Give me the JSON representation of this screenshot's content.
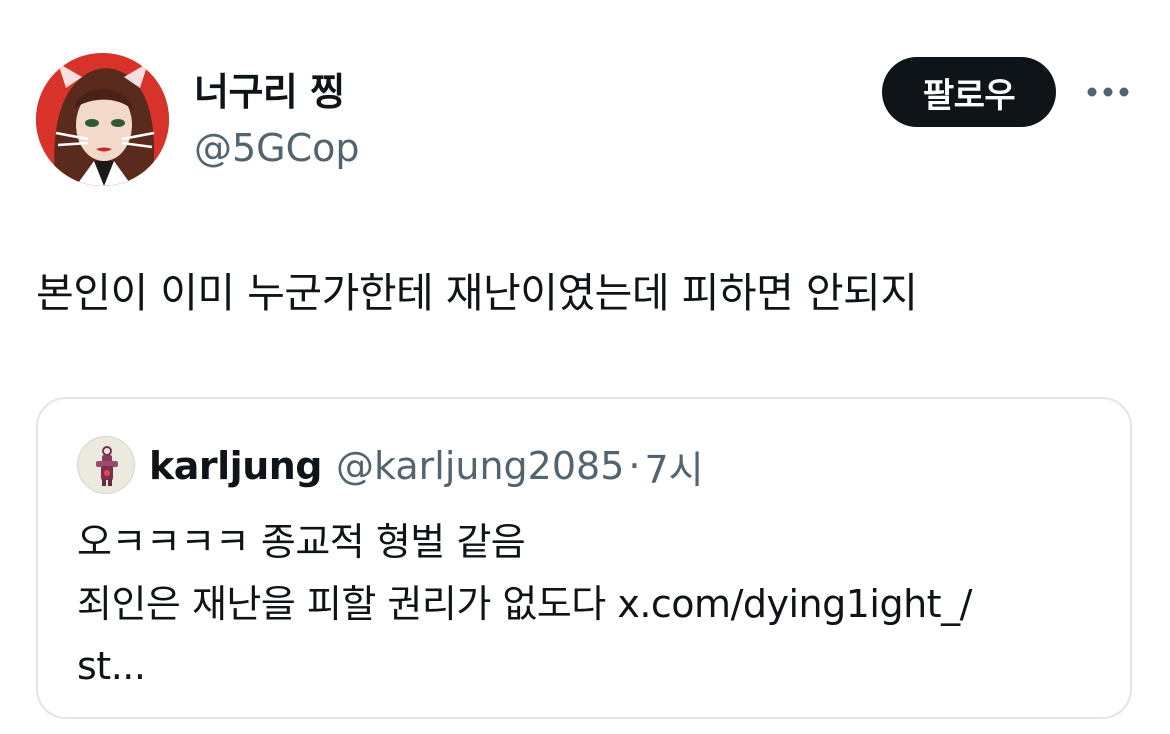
{
  "author": {
    "display_name": "너구리 찡",
    "handle": "@5GCop",
    "avatar_icon": "avatar-portrait"
  },
  "actions": {
    "follow_label": "팔로우",
    "more_icon": "more-horizontal-icon"
  },
  "tweet": {
    "text": "본인이 이미 누군가한테 재난이였는데 피하면 안되지"
  },
  "quote": {
    "display_name": "karljung",
    "handle": "@karljung2085",
    "separator": "·",
    "time": "7시",
    "lines": [
      "오ㅋㅋㅋㅋ 종교적 형벌 같음",
      "죄인은 재난을 피할 권리가 없도다 x.com/dying1ight_/",
      "st..."
    ]
  },
  "colors": {
    "text_primary": "#0f1419",
    "text_secondary": "#536471",
    "follow_bg": "#0f1419",
    "card_border": "#e1e6ea",
    "avatar_bg": "#d7332b"
  }
}
